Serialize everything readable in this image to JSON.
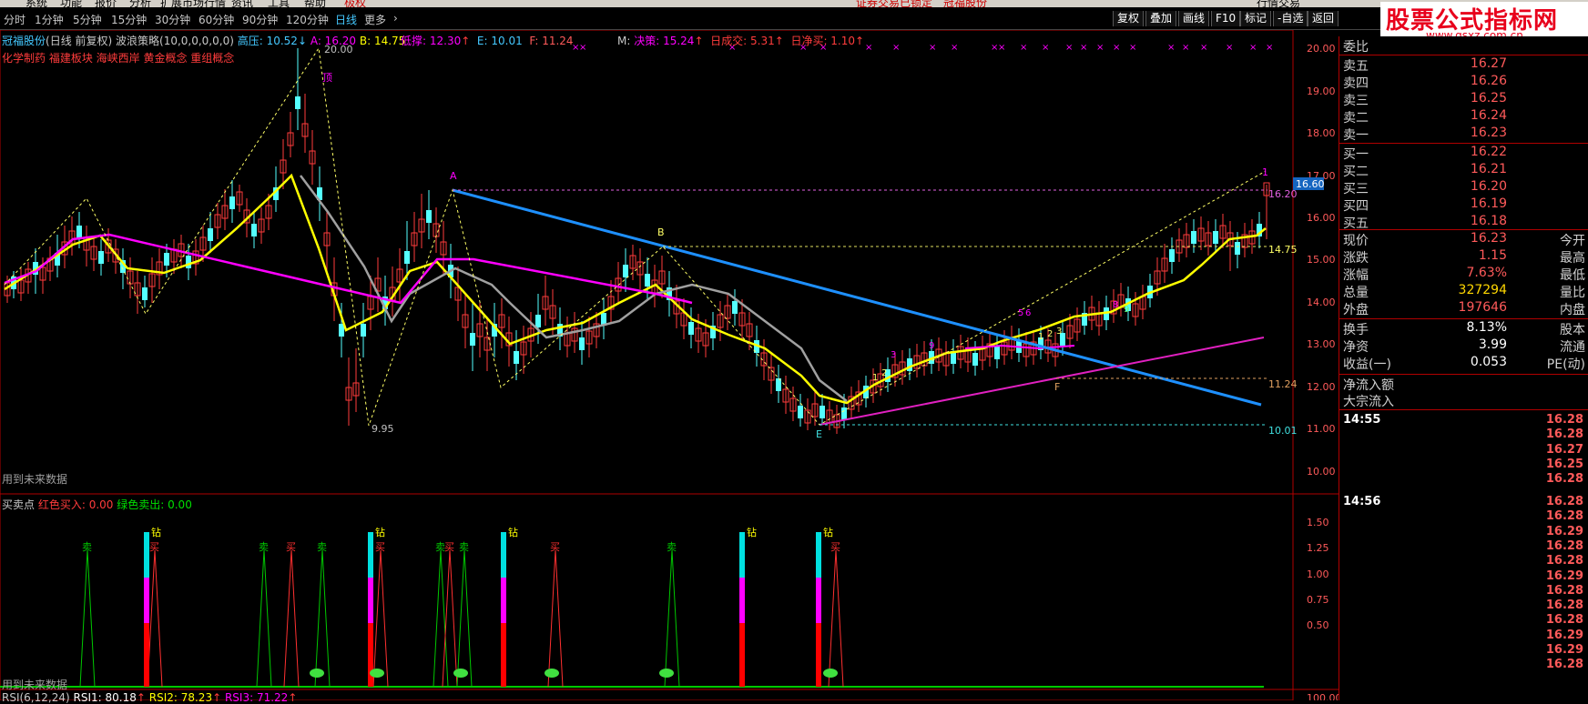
{
  "menu": [
    "系统",
    "功能",
    "报价",
    "分析",
    "扩展市场行情",
    "资讯",
    "工具",
    "帮助",
    "极权",
    "证券交易已锁定",
    "冠福股份",
    "行情交易"
  ],
  "periods": [
    "分时",
    "1分钟",
    "5分钟",
    "15分钟",
    "30分钟",
    "60分钟",
    "90分钟",
    "120分钟",
    "日线",
    "更多"
  ],
  "toolbar_buttons": [
    "复权",
    "叠加",
    "画线",
    "F10",
    "标记",
    "-自选",
    "返回"
  ],
  "brand": {
    "title": "股票公式指标网",
    "url": "www.gsxz.com.cn"
  },
  "stock_header": {
    "name": "冠福股份",
    "suffix": "(日线 前复权) 波浪策略(10,0,0,0,0,0)",
    "pressure": "高压: 10.52",
    "a": "A: 16.20",
    "b": "B: 14.75",
    "low_support": "低撑: 12.30",
    "e": "E: 10.01",
    "f": "F: 11.24",
    "m": "M:",
    "decision": "决策: 15.24",
    "day_vol": "日成交: 5.31",
    "day_net": "日净买: 1.10",
    "concepts": "化学制药 福建板块 海峡西岸 黄金概念 重组概念",
    "future_note": "用到未来数据"
  },
  "price_axis": [
    "20.00",
    "19.00",
    "18.00",
    "17.00",
    "16.00",
    "15.00",
    "14.00",
    "13.00",
    "12.00",
    "11.00",
    "10.00"
  ],
  "price_tags": {
    "current": "16.60",
    "a": "16.20",
    "b": "14.75",
    "f": "11.24",
    "e": "10.01",
    "high": "20.00",
    "low": "9.95",
    "top": "顶",
    "point1": "1"
  },
  "wave_labels": [
    "A",
    "B",
    "F",
    "E",
    "F"
  ],
  "indicator_header": {
    "title": "买卖点",
    "red": "红色买入: 0.00",
    "green": "绿色卖出: 0.00",
    "future_note": "用到未来数据"
  },
  "indicator_axis": [
    "1.50",
    "1.25",
    "1.00",
    "0.75",
    "0.50"
  ],
  "signal_labels": {
    "diamond": "钻",
    "sell": "卖",
    "buy": "买"
  },
  "rsi_bar": {
    "label": "RSI(6,12,24)",
    "rsi1": "RSI1: 80.18",
    "rsi2": "RSI2: 78.23",
    "rsi3": "RSI3: 71.22",
    "axis": "100.00"
  },
  "quote": {
    "weibi": "委比",
    "asks": [
      {
        "label": "卖五",
        "price": "16.27"
      },
      {
        "label": "卖四",
        "price": "16.26"
      },
      {
        "label": "卖三",
        "price": "16.25"
      },
      {
        "label": "卖二",
        "price": "16.24"
      },
      {
        "label": "卖一",
        "price": "16.23"
      }
    ],
    "bids": [
      {
        "label": "买一",
        "price": "16.22"
      },
      {
        "label": "买二",
        "price": "16.21"
      },
      {
        "label": "买三",
        "price": "16.20"
      },
      {
        "label": "买四",
        "price": "16.19"
      },
      {
        "label": "买五",
        "price": "16.18"
      }
    ],
    "stats": [
      {
        "label": "现价",
        "value": "16.23",
        "label2": "今开",
        "color": "#ff5a5a"
      },
      {
        "label": "涨跌",
        "value": "1.15",
        "label2": "最高",
        "color": "#ff5a5a"
      },
      {
        "label": "涨幅",
        "value": "7.63%",
        "label2": "最低",
        "color": "#ff5a5a"
      },
      {
        "label": "总量",
        "value": "327294",
        "label2": "量比",
        "color": "#ffd700"
      },
      {
        "label": "外盘",
        "value": "197646",
        "label2": "内盘",
        "color": "#ff5a5a"
      }
    ],
    "fin": [
      {
        "label": "换手",
        "value": "8.13%",
        "label2": "股本"
      },
      {
        "label": "净资",
        "value": "3.99",
        "label2": "流通"
      },
      {
        "label": "收益(一)",
        "value": "0.053",
        "label2": "PE(动)"
      }
    ],
    "flow": [
      "净流入额",
      "大宗流入"
    ],
    "ticks1": {
      "time": "14:55",
      "values": [
        "16.28",
        "16.28",
        "16.27",
        "16.25",
        "16.28"
      ]
    },
    "ticks2": {
      "time": "14:56",
      "values": [
        "16.28",
        "16.28",
        "16.29",
        "16.28",
        "16.28",
        "16.29",
        "16.28",
        "16.28",
        "16.28",
        "16.29",
        "16.29",
        "16.28"
      ]
    }
  },
  "colors": {
    "up": "#ff3c3c",
    "down": "#54ffff",
    "ma_yellow": "#ffff00",
    "ma_gray": "#a0a0a0",
    "ma_magenta": "#ff00ff",
    "trend_blue": "#1e90ff",
    "trend_magenta": "#e020c0",
    "axis_red": "#b00000"
  }
}
